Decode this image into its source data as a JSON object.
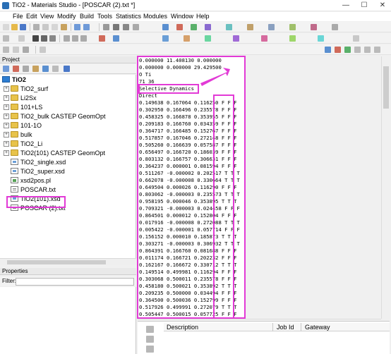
{
  "window": {
    "title": "TiO2 - Materials Studio - [POSCAR (2).txt *]",
    "minimize": "—",
    "maximize": "☐",
    "close": "✕"
  },
  "menu": [
    "File",
    "Edit",
    "View",
    "Modify",
    "Build",
    "Tools",
    "Statistics",
    "Modules",
    "Window",
    "Help"
  ],
  "project": {
    "header": "Project",
    "root": "TiO2",
    "items": [
      {
        "label": "TiO2_surf",
        "type": "folder"
      },
      {
        "label": "Li2Sx",
        "type": "folder"
      },
      {
        "label": "101+LS",
        "type": "folder"
      },
      {
        "label": "TiO2_bulk CASTEP GeomOpt",
        "type": "folder"
      },
      {
        "label": "101-1O",
        "type": "folder"
      },
      {
        "label": "bulk",
        "type": "folder"
      },
      {
        "label": "TiO2_Li",
        "type": "folder"
      },
      {
        "label": "TiO2(101) CASTEP GeomOpt",
        "type": "folder"
      },
      {
        "label": "TiO2_single.xsd",
        "type": "xsd"
      },
      {
        "label": "TiO2_super.xsd",
        "type": "xsd"
      },
      {
        "label": "xsd2pos.pl",
        "type": "pl"
      },
      {
        "label": "POSCAR.txt",
        "type": "txt"
      },
      {
        "label": "TiO2(101).xsd",
        "type": "xsd"
      },
      {
        "label": "POSCAR (2).txt",
        "type": "txt"
      }
    ]
  },
  "properties": {
    "header": "Properties",
    "filter_label": "Filter:",
    "filter_value": ""
  },
  "editor": {
    "lines": [
      "0.000000 11.408130 0.000000",
      "0.000000 0.000000 29.429500",
      "O Ti",
      "71 36",
      "Selective Dynamics",
      "Direct",
      "0.149638 0.167064 0.116250 F F F",
      "0.302950 0.166496 0.235578 F F F",
      "0.458325 0.166878 0.353955 F F F",
      "0.209183 0.166760 0.034359 F F F",
      "0.364717 0.166485 0.152767 F F F",
      "0.517857 0.167046 0.272148 F F F",
      "0.505260 0.166639 0.057587 F F F",
      "0.656497 0.166720 0.186039 F F F",
      "0.803132 0.166757 0.306631 F F F",
      "0.364237 0.000001 0.081594 F F F",
      "0.511267 -0.000002 0.202517 T T T",
      "0.662078 -0.000008 0.330664 T T T",
      "0.649504 0.000026 0.116290 F F F",
      "0.803062 -0.000003 0.235573 T T T",
      "0.958195 0.000046 0.353895 T T T",
      "0.709321 -0.000003 0.024458 F F F",
      "0.864501 0.000012 0.152804 F F F",
      "0.017916 -0.000008 0.272088 T T T",
      "0.005422 -0.000001 0.057714 F F F",
      "0.156152 0.000010 0.185873 T T T",
      "0.303271 -0.000003 0.306932 T T T",
      "0.864391 0.166760 0.081688 F F F",
      "0.011174 0.166721 0.202232 F F F",
      "0.162167 0.166672 0.330712 T T T",
      "0.149514 0.499981 0.116294 F F F",
      "0.303068 0.500011 0.235578 F F F",
      "0.458180 0.500021 0.353892 T T T",
      "0.209235 0.500000 0.034494 F F F",
      "0.364500 0.500036 0.152799 F F F",
      "0.517926 0.499991 0.272079 T T T",
      "0.505447 0.500015 0.057725 F F F"
    ]
  },
  "jobs": {
    "columns": [
      "Description",
      "Job Id",
      "Gateway"
    ]
  },
  "colors": {
    "highlight": "#e23ad6",
    "root_icon": "#2d7dd2",
    "folder": "#e8c34a"
  }
}
